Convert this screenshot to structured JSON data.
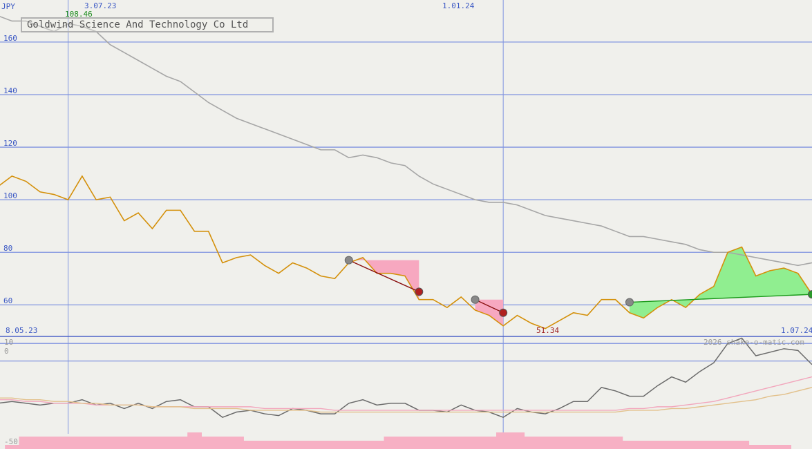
{
  "title": "Goldwind Science And Technology Co Ltd",
  "currency": "JPY",
  "watermark": "2026 shake-o-matic.com",
  "date_labels": {
    "top_left": "3.07.23",
    "top_mid": "1.01.24",
    "bottom_left": "8.05.23",
    "bottom_right": "1.07.24"
  },
  "max_label": "108.46",
  "min_label": "51.34",
  "colors": {
    "price": "#d4900a",
    "ma_long": "#a6a6a6",
    "grid": "#7f93e0",
    "gain_fill": "#90ee90",
    "loss_fill": "#f7a8c0",
    "bars": "#f7b0c4"
  },
  "chart_data": [
    {
      "type": "line",
      "title": "Goldwind Science And Technology Co Ltd",
      "ylabel": "JPY",
      "yticks": [
        60,
        80,
        100,
        120,
        140,
        160
      ],
      "ylim": [
        48,
        176
      ],
      "x_labels": [
        "3.07.23",
        "1.01.24"
      ],
      "series": [
        {
          "values": [
            105,
            109,
            107,
            103,
            102,
            100,
            109,
            100,
            101,
            92,
            95,
            89,
            96,
            96,
            88,
            88,
            76,
            78,
            79,
            75,
            72,
            76,
            74,
            71,
            70,
            76,
            78,
            72,
            72,
            71,
            62,
            62,
            59,
            63,
            58,
            56,
            52,
            56,
            53,
            51,
            54,
            57,
            56,
            62,
            62,
            57,
            55,
            59,
            62,
            59,
            64,
            67,
            80,
            82,
            71,
            73,
            74,
            72,
            64
          ]
        },
        {
          "values": [
            170,
            168,
            168,
            166,
            164,
            167,
            166,
            164,
            159,
            156,
            153,
            150,
            147,
            145,
            141,
            137,
            134,
            131,
            129,
            127,
            125,
            123,
            121,
            119,
            119,
            116,
            117,
            116,
            114,
            113,
            109,
            106,
            104,
            102,
            100,
            99,
            99,
            98,
            96,
            94,
            93,
            92,
            91,
            90,
            88,
            86,
            86,
            85,
            84,
            83,
            81,
            80,
            80,
            79,
            78,
            77,
            76,
            75,
            76
          ]
        }
      ],
      "annotations": [
        {
          "text": "108.46",
          "value": 108.46
        },
        {
          "text": "51.34",
          "value": 51.34
        }
      ],
      "trades": [
        {
          "from_index": 25,
          "from_value": 77,
          "to_index": 30,
          "to_value": 65,
          "result": "loss"
        },
        {
          "from_index": 34,
          "from_value": 62,
          "to_index": 36,
          "to_value": 57,
          "result": "loss"
        },
        {
          "from_index": 45,
          "from_value": 61,
          "to_index": 58,
          "to_value": 64,
          "result": "gain"
        }
      ]
    },
    {
      "type": "line",
      "ylim": [
        -50,
        14
      ],
      "yticks": [
        -50,
        0,
        10
      ],
      "x_labels": [
        "8.05.23",
        "1.07.24"
      ],
      "series": [
        {
          "values": [
            -24,
            -23,
            -24,
            -25,
            -24,
            -24,
            -22,
            -25,
            -24,
            -27,
            -24,
            -27,
            -23,
            -22,
            -26,
            -26,
            -32,
            -29,
            -28,
            -30,
            -31,
            -27,
            -28,
            -30,
            -30,
            -24,
            -22,
            -25,
            -24,
            -24,
            -28,
            -28,
            -29,
            -25,
            -28,
            -29,
            -32,
            -27,
            -29,
            -30,
            -27,
            -23,
            -23,
            -15,
            -17,
            -20,
            -20,
            -14,
            -9,
            -12,
            -6,
            -1,
            10,
            13,
            3,
            5,
            7,
            6,
            -2
          ]
        },
        {
          "values": [
            -22,
            -22,
            -23,
            -23,
            -24,
            -24,
            -24,
            -25,
            -25,
            -25,
            -25,
            -26,
            -26,
            -26,
            -26,
            -26,
            -26,
            -26,
            -26,
            -27,
            -27,
            -27,
            -27,
            -27,
            -28,
            -28,
            -28,
            -28,
            -28,
            -28,
            -28,
            -28,
            -28,
            -28,
            -28,
            -28,
            -28,
            -28,
            -28,
            -28,
            -28,
            -28,
            -28,
            -28,
            -28,
            -27,
            -27,
            -26,
            -26,
            -25,
            -24,
            -23,
            -21,
            -19,
            -17,
            -15,
            -13,
            -11,
            -9
          ]
        },
        {
          "values": [
            -21,
            -21,
            -22,
            -22,
            -23,
            -23,
            -24,
            -24,
            -25,
            -25,
            -25,
            -26,
            -26,
            -26,
            -27,
            -27,
            -27,
            -27,
            -28,
            -28,
            -28,
            -28,
            -28,
            -29,
            -29,
            -29,
            -29,
            -29,
            -29,
            -29,
            -29,
            -29,
            -29,
            -29,
            -29,
            -29,
            -29,
            -29,
            -29,
            -29,
            -29,
            -29,
            -29,
            -29,
            -29,
            -28,
            -28,
            -28,
            -27,
            -27,
            -26,
            -25,
            -24,
            -23,
            -22,
            -20,
            -19,
            -17,
            -15
          ]
        }
      ],
      "bars": [
        0,
        1,
        3,
        3,
        3,
        3,
        3,
        3,
        3,
        3,
        3,
        3,
        3,
        3,
        4,
        3,
        3,
        3,
        2,
        2,
        2,
        2,
        2,
        2,
        2,
        2,
        2,
        2,
        3,
        3,
        3,
        3,
        3,
        3,
        3,
        3,
        4,
        4,
        3,
        3,
        3,
        3,
        3,
        3,
        3,
        2,
        2,
        2,
        2,
        2,
        2,
        2,
        2,
        2,
        1,
        1,
        1,
        0,
        0
      ]
    }
  ]
}
